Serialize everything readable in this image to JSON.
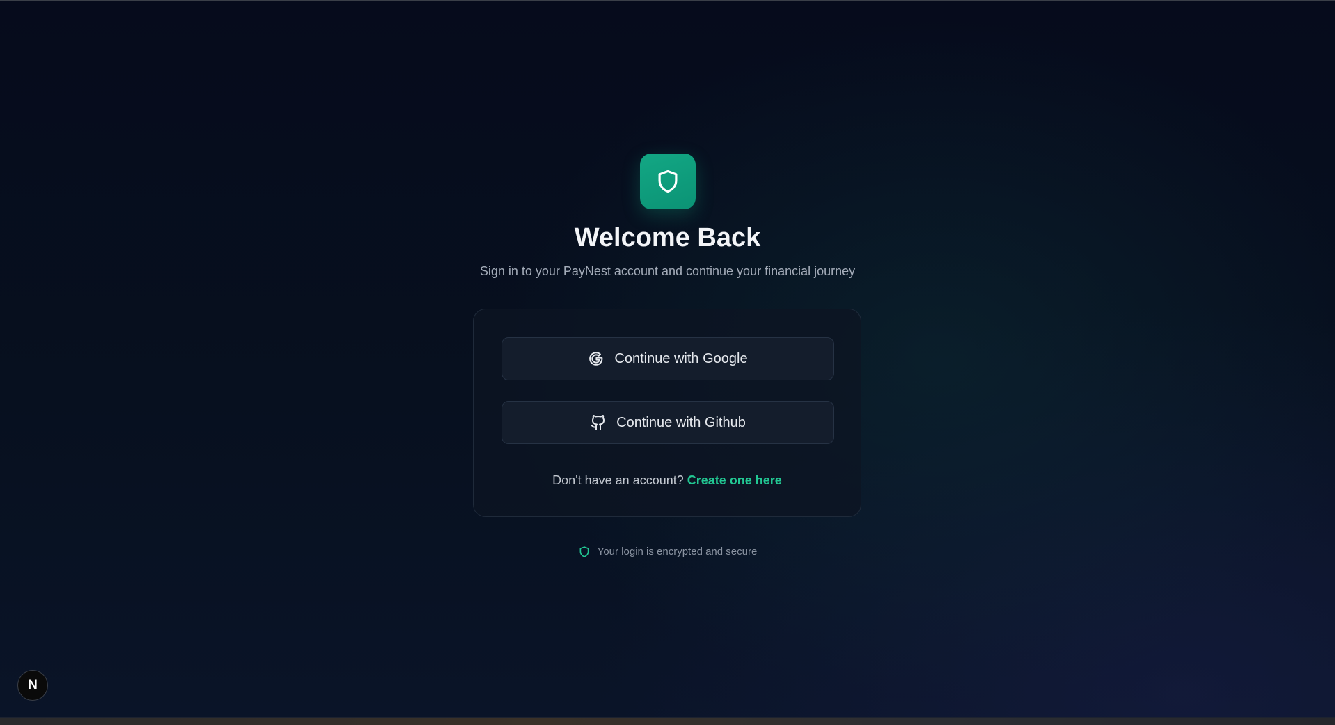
{
  "header": {
    "logo_icon": "shield-icon",
    "title": "Welcome Back",
    "subtitle": "Sign in to your PayNest account and continue your financial journey"
  },
  "auth_card": {
    "google_button": {
      "icon": "google-icon",
      "label": "Continue with Google"
    },
    "github_button": {
      "icon": "github-icon",
      "label": "Continue with Github"
    },
    "signup_prompt": "Don't have an account?",
    "signup_link": "Create one here"
  },
  "security_note": {
    "icon": "shield-icon",
    "text": "Your login is encrypted and secure"
  },
  "dev_badge": {
    "icon": "nextjs-icon",
    "label": "N"
  },
  "colors": {
    "accent": "#13a784",
    "link": "#22c893",
    "background": "#060b1c",
    "card": "#0d1523",
    "button": "#141d2c"
  }
}
